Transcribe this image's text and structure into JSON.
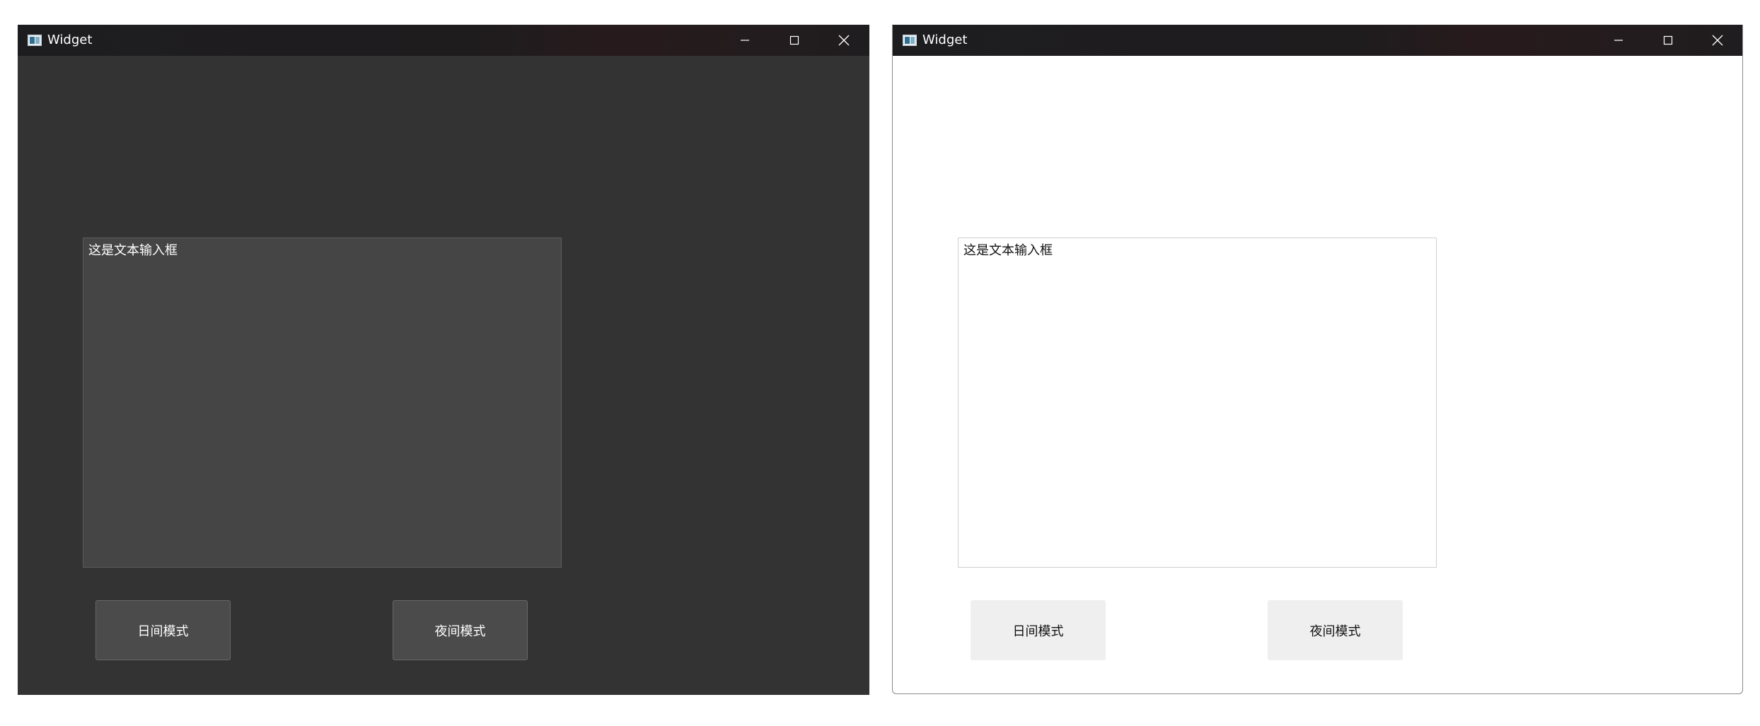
{
  "windows": [
    {
      "theme": "dark",
      "title": "Widget",
      "textbox_text": "这是文本输入框",
      "day_button_label": "日间模式",
      "night_button_label": "夜间模式"
    },
    {
      "theme": "light",
      "title": "Widget",
      "textbox_text": "这是文本输入框",
      "day_button_label": "日间模式",
      "night_button_label": "夜间模式"
    }
  ],
  "icons": {
    "app": "app-window-icon",
    "minimize": "minimize-icon",
    "maximize": "maximize-icon",
    "close": "close-icon"
  },
  "colors": {
    "dark_background": "#333333",
    "dark_textbox": "#454545",
    "dark_button": "#4b4b4b",
    "light_background": "#ffffff",
    "light_button": "#efefef",
    "titlebar": "#1d1d1f"
  }
}
